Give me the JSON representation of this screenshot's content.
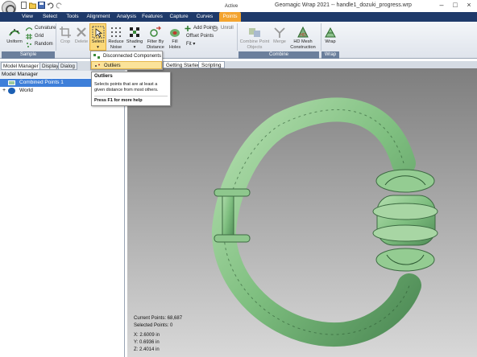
{
  "window": {
    "title": "Geomagic Wrap 2021 -- handle1_dozuki_progress.wrp",
    "context_label": "Active"
  },
  "ribbon_tabs": [
    "View",
    "Select",
    "Tools",
    "Alignment",
    "Analysis",
    "Features",
    "Capture",
    "Curves",
    "Points"
  ],
  "active_tab": "Points",
  "groups": {
    "sample": "Sample",
    "combine": "Combine",
    "wrap": "Wrap"
  },
  "buttons": {
    "uniform": "Uniform",
    "curvature": "Curvature",
    "grid": "Grid",
    "random": "Random",
    "crop": "Crop",
    "delete": "Delete",
    "select": "Select",
    "reduce_noise_1": "Reduce",
    "reduce_noise_2": "Noise",
    "shading": "Shading",
    "filter_1": "Filter By",
    "filter_2": "Distance",
    "fill_holes_1": "Fill",
    "fill_holes_2": "Holes",
    "add_points": "Add Points",
    "offset_points": "Offset Points",
    "fit": "Fit",
    "unroll": "Unroll",
    "combine_1": "Combine Point",
    "combine_2": "Objects",
    "merge": "Merge",
    "hd_mesh_1": "HD Mesh",
    "hd_mesh_2": "Construction",
    "wrap": "Wrap"
  },
  "panel_tabs": [
    "Model Manager",
    "Display",
    "Dialog"
  ],
  "model_manager": {
    "header": "Model Manager",
    "items": [
      {
        "label": "Combined Points 1",
        "selected": true
      },
      {
        "label": "World",
        "selected": false
      }
    ]
  },
  "viewport_tabs": [
    "Getting Started",
    "Scripting"
  ],
  "dropdown": {
    "items": [
      "Disconnected Components",
      "Outliers"
    ],
    "highlighted": "Outliers"
  },
  "tooltip": {
    "title": "Outliers",
    "body": "Selects points that are at least a given distance from most others.",
    "footer": "Press F1 for more help"
  },
  "viewport_info": {
    "current_points": "Current Points: 68,687",
    "selected_points": "Selected Points: 0",
    "x": "X:  2.6009 in",
    "y": "Y:  0.6936 in",
    "z": "Z:  2.4014 in"
  },
  "colors": {
    "tab_bar": "#1f3a6a",
    "active_tab": "#f3a430",
    "model": "#8cc08c",
    "selection": "#3e7fd9"
  }
}
